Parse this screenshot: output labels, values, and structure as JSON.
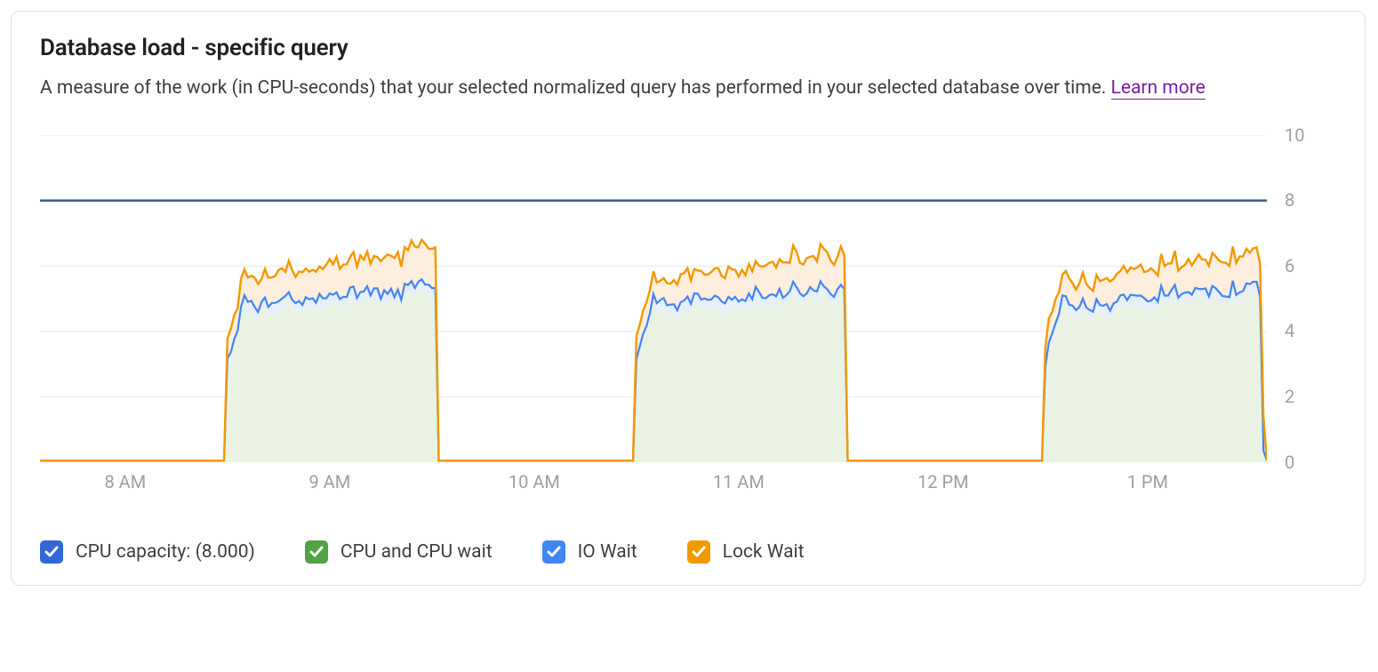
{
  "card": {
    "title": "Database load - specific query",
    "subtitle_prefix": "A measure of the work (in CPU-seconds) that your selected normalized query has performed in your selected database over time. ",
    "learn_more": "Learn more"
  },
  "legend": {
    "cpu_capacity": "CPU capacity: (8.000)",
    "cpu_wait": "CPU and CPU wait",
    "io_wait": "IO Wait",
    "lock_wait": "Lock Wait"
  },
  "colors": {
    "cpu_capacity_line": "#3b5f8a",
    "cpu_wait_fill": "#eaf2e4",
    "cpu_wait_stroke": "#60a14a",
    "io_wait_fill": "#e7effb",
    "io_wait_stroke": "#4285f4",
    "lock_wait_fill": "#fdeedd",
    "lock_wait_stroke": "#f29900",
    "legend_cpu_cap": "#3367d6",
    "legend_cpu_wait": "#53a243",
    "legend_io": "#4285f4",
    "legend_lock": "#f29900"
  },
  "chart_data": {
    "type": "area",
    "xlabel": "",
    "ylabel": "",
    "ylim": [
      0,
      10
    ],
    "x_ticks": [
      "8 AM",
      "9 AM",
      "10 AM",
      "11 AM",
      "12 PM",
      "1 PM"
    ],
    "y_ticks": [
      0,
      2,
      4,
      6,
      8,
      10
    ],
    "cpu_capacity": 8.0,
    "time_step_minutes": 1,
    "time_start": "7:35 AM",
    "time_end": "1:35 PM",
    "stacking_order_bottom_to_top": [
      "cpu_wait",
      "io_wait",
      "lock_wait"
    ],
    "series": [
      {
        "name": "CPU and CPU wait",
        "key": "cpu_wait",
        "note": "bottom stacked layer — reaches ~5.0 at peak of each burst"
      },
      {
        "name": "IO Wait",
        "key": "io_wait",
        "note": "thin layer on top of CPU wait — adds ~0.3 (blue line visible just above green fill)"
      },
      {
        "name": "Lock Wait",
        "key": "lock_wait",
        "note": "top layer — adds ~1.2 (orange line reaches ~6.5 at peak)"
      }
    ],
    "bursts": [
      {
        "start": "8:30 AM",
        "end": "9:32 AM",
        "peak_total": 6.6,
        "plateau_cpu": 5.1,
        "ramp_minutes": 6
      },
      {
        "start": "10:30 AM",
        "end": "11:32 AM",
        "peak_total": 6.5,
        "plateau_cpu": 5.1,
        "ramp_minutes": 6
      },
      {
        "start": "12:30 PM",
        "end": "1:34 PM",
        "peak_total": 6.5,
        "plateau_cpu": 5.1,
        "ramp_minutes": 6
      }
    ],
    "idle_value": 0.05
  }
}
